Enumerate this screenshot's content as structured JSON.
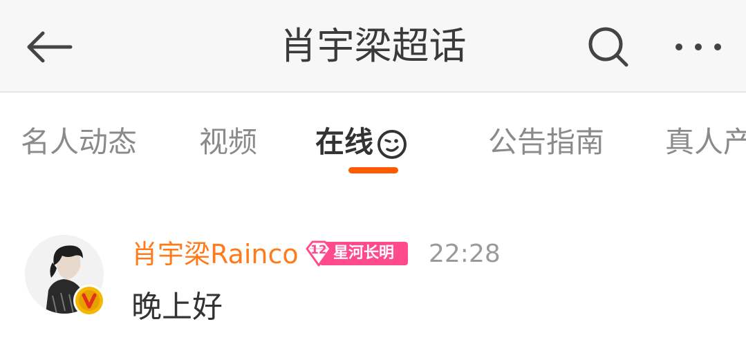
{
  "header": {
    "title": "肖宇梁超话",
    "back_icon": "back-arrow-icon",
    "search_icon": "search-icon",
    "more_icon": "more-dots-icon"
  },
  "tabs": [
    {
      "label": "名人动态"
    },
    {
      "label": "视频"
    },
    {
      "label": "在线",
      "active": true,
      "icon": "smiley-wink-icon"
    },
    {
      "label": "公告指南"
    },
    {
      "label": "真人产"
    }
  ],
  "colors": {
    "accent": "#ff5a00",
    "username": "#ff7a1a",
    "fan_badge": "#ff4a8c",
    "verified_badge": "#f5b800"
  },
  "message": {
    "username": "肖宇梁Rainco",
    "fan_badge_level": "12",
    "fan_badge_text": "星河长明",
    "time": "22:28",
    "text": "晚上好",
    "verified_icon": "verified-v-icon"
  }
}
